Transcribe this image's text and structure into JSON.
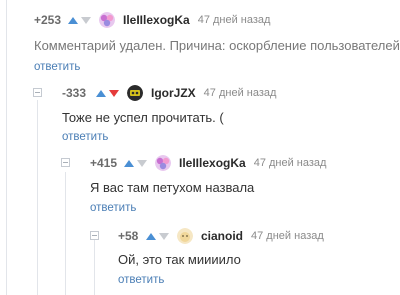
{
  "comments": [
    {
      "rating": "+253",
      "username": "IleIIlexogKa",
      "time": "47 дней назад",
      "text": "Комментарий удален. Причина: оскорбление пользователей.",
      "reply": "ответить",
      "avatar_color": "#c86fd1"
    },
    {
      "rating": "-333",
      "username": "IgorJZX",
      "time": "47 дней назад",
      "text": "Тоже не успел прочитать. (",
      "reply": "ответить",
      "avatar_color": "#d6c21c"
    },
    {
      "rating": "+415",
      "username": "IleIIlexogKa",
      "time": "47 дней назад",
      "text": "Я вас там петухом назвала",
      "reply": "ответить",
      "avatar_color": "#c86fd1"
    },
    {
      "rating": "+58",
      "username": "cianoid",
      "time": "47 дней назад",
      "text": "Ой, это так миииило",
      "reply": "ответить",
      "avatar_color": "#f1d79a"
    }
  ],
  "colors": {
    "upvote": "#4a8fd4",
    "downvote_active": "#e53b3b",
    "link": "#4a7eb5"
  }
}
